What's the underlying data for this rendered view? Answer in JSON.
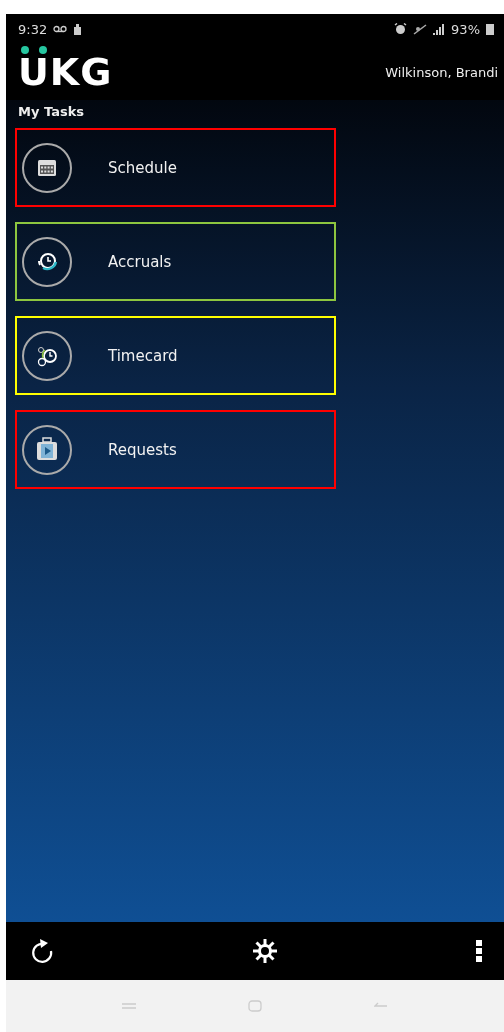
{
  "status_bar": {
    "time": "9:32",
    "battery": "93%"
  },
  "header": {
    "logo": "UKG",
    "user": "Wilkinson, Brandi"
  },
  "section_title": "My Tasks",
  "tasks": [
    {
      "label": "Schedule",
      "kind": "calendar",
      "color": "#ff0000"
    },
    {
      "label": "Accruals",
      "kind": "accrual",
      "color": "#8dc63f"
    },
    {
      "label": "Timecard",
      "kind": "timecard",
      "color": "#ffff00"
    },
    {
      "label": "Requests",
      "kind": "suitcase",
      "color": "#ff0000"
    }
  ]
}
